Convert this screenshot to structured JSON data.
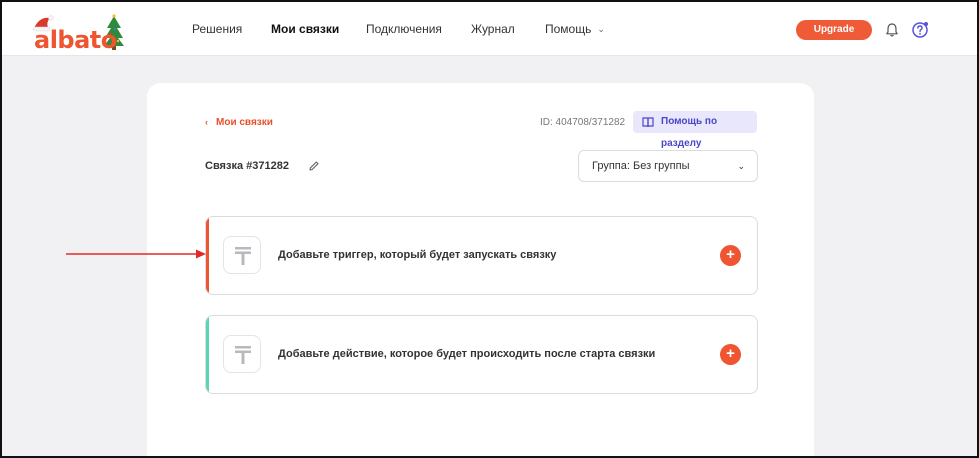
{
  "brand": {
    "logo_text": "albato",
    "accent": "#ee5530"
  },
  "nav": {
    "items": [
      {
        "label": "Решения"
      },
      {
        "label": "Мои связки"
      },
      {
        "label": "Подключения"
      },
      {
        "label": "Журнал"
      },
      {
        "label": "Помощь"
      }
    ],
    "upgrade_label": "Upgrade"
  },
  "page": {
    "back_label": "Мои связки",
    "id_text": "ID: 404708/371282",
    "help_label": "Помощь по разделу",
    "title": "Связка #371282",
    "group_select": "Группа: Без группы"
  },
  "steps": [
    {
      "label": "Добавьте триггер, который будет запускать связку",
      "accent": "#ee5530"
    },
    {
      "label": "Добавьте действие, которое будет происходить после старта связки",
      "accent": "#5ad6b4"
    }
  ],
  "icons": {
    "bell": "bell-icon",
    "help": "help-question-icon",
    "book": "book-icon",
    "pencil": "pencil-icon",
    "placeholder": "service-placeholder-icon"
  }
}
